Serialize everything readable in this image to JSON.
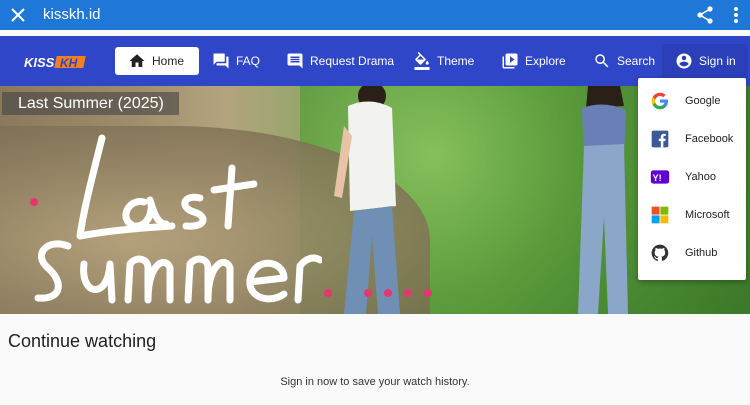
{
  "browser": {
    "url": "kisskh.id"
  },
  "nav": {
    "home": "Home",
    "faq": "FAQ",
    "request": "Request Drama",
    "theme": "Theme",
    "explore": "Explore",
    "search": "Search",
    "signin": "Sign in"
  },
  "banner": {
    "title": "Last Summer (2025)",
    "slide_count": 5
  },
  "signin_menu": [
    {
      "label": "Google",
      "icon": "google-icon"
    },
    {
      "label": "Facebook",
      "icon": "facebook-icon"
    },
    {
      "label": "Yahoo",
      "icon": "yahoo-icon"
    },
    {
      "label": "Microsoft",
      "icon": "microsoft-icon"
    },
    {
      "label": "Github",
      "icon": "github-icon"
    }
  ],
  "continue_watching": {
    "title": "Continue watching",
    "message": "Sign in now to save your watch history."
  },
  "colors": {
    "browser_bar": "#1f78d8",
    "navbar": "#2f46c8",
    "accent_dot": "#e6366f",
    "logo_orange": "#f08020"
  }
}
